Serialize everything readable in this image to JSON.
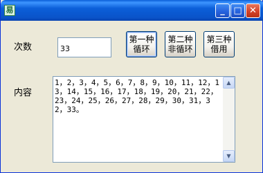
{
  "window": {
    "icon": "app-icon",
    "icon_glyph": "易",
    "controls": {
      "minimize": "_",
      "maximize": "□",
      "close": "✕"
    }
  },
  "labels": {
    "count": "次数",
    "content": "内容"
  },
  "count_input": {
    "value": "33"
  },
  "buttons": {
    "first": "第一种\n循环",
    "second": "第二种\n非循环",
    "third": "第三种\n借用"
  },
  "content_text": "1，2，3，4，5，6，7，8，9，10，11，12，13，14，15，16，17，18，19，20，21，22，23，24，25，26，27，28，29，30，31，32，33。",
  "colors": {
    "titlebar": "#0a53c9",
    "window_bg": "#ece9d8",
    "close_button": "#d4432a"
  },
  "scrollbar": {
    "up_icon": "▲",
    "down_icon": "▼"
  }
}
